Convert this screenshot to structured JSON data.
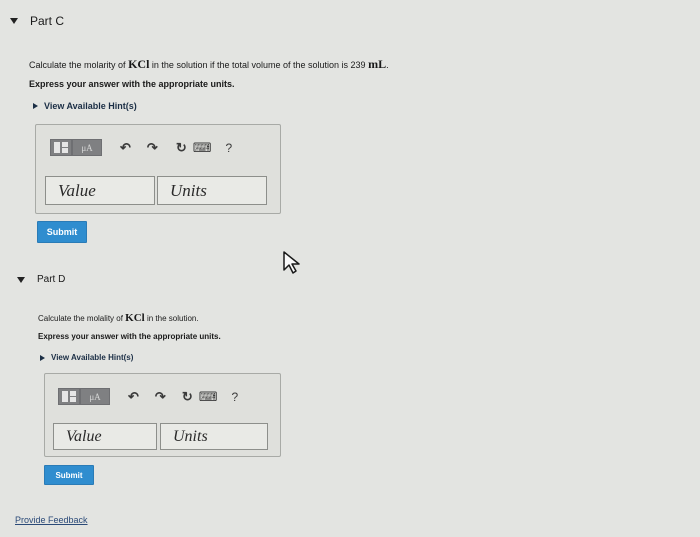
{
  "partC": {
    "title": "Part C",
    "question": "Calculate the molarity of",
    "chem": "KCl",
    "question_tail": "in the solution if the total volume of the solution is 239",
    "unit": "mL",
    "instruction": "Express your answer with the appropriate units.",
    "hint": "View Available Hint(s)",
    "toolbar": {
      "templates": "",
      "mu": "μA",
      "undo": "↶",
      "redo": "↷",
      "reset": "↻",
      "keyboard": "⌨",
      "help": "?"
    },
    "value_placeholder": "Value",
    "units_placeholder": "Units",
    "submit": "Submit"
  },
  "partD": {
    "title": "Part D",
    "question": "Calculate the molality of",
    "chem": "KCl",
    "question_tail": "in the solution.",
    "instruction": "Express your answer with the appropriate units.",
    "hint": "View Available Hint(s)",
    "toolbar": {
      "templates": "",
      "mu": "μA",
      "undo": "↶",
      "redo": "↷",
      "reset": "↻",
      "keyboard": "⌨",
      "help": "?"
    },
    "value_placeholder": "Value",
    "units_placeholder": "Units",
    "submit": "Submit"
  },
  "footer": {
    "feedback": "Provide Feedback"
  }
}
